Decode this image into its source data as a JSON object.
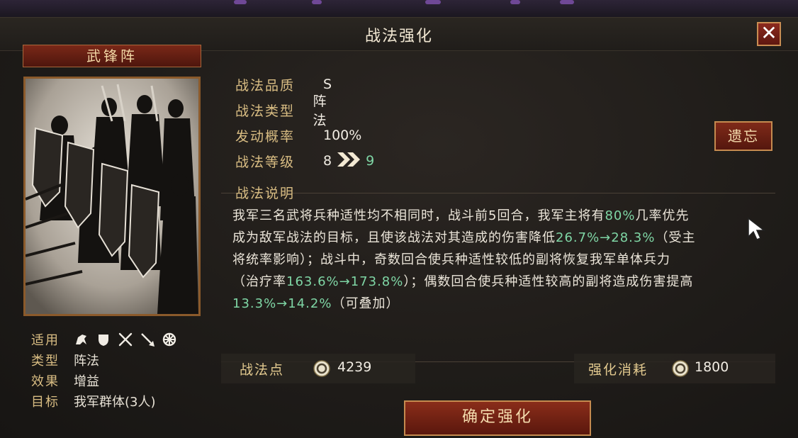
{
  "window": {
    "title": "战法强化",
    "close_label": "✕"
  },
  "skill": {
    "name": "武锋阵"
  },
  "properties": [
    {
      "label": "适用",
      "icons": [
        "cavalry-icon",
        "shield-icon",
        "crossed-swords-icon",
        "spear-icon",
        "wheel-icon"
      ]
    },
    {
      "label": "类型",
      "value": "阵法"
    },
    {
      "label": "效果",
      "value": "增益"
    },
    {
      "label": "目标",
      "value": "我军群体(3人)"
    }
  ],
  "info": {
    "quality_label": "战法品质",
    "quality_value": "S",
    "type_label": "战法类型",
    "type_value": "阵法",
    "rate_label": "发动概率",
    "rate_value": "100%",
    "level_label": "战法等级",
    "level_current": "8",
    "level_next": "9"
  },
  "forget_button": "遗忘",
  "description": {
    "title": "战法说明",
    "lines": [
      [
        {
          "t": "我军三名武将兵种适性均不相同时，战斗前5回合，我军主将有"
        },
        {
          "t": "80%",
          "hl": true
        },
        {
          "t": "几率优先"
        }
      ],
      [
        {
          "t": "成为敌军战法的目标，且使该战法对其造成的伤害降低"
        },
        {
          "t": "26.7%→28.3%",
          "hl": true
        },
        {
          "t": "（受主"
        }
      ],
      [
        {
          "t": "将统率影响）；战斗中，奇数回合使兵种适性较低的副将恢复我军单体兵力"
        }
      ],
      [
        {
          "t": "（治疗率"
        },
        {
          "t": "163.6%→173.8%",
          "hl": true
        },
        {
          "t": "）；偶数回合使兵种适性较高的副将造成伤害提高"
        }
      ],
      [
        {
          "t": "13.3%→14.2%",
          "hl": true
        },
        {
          "t": "（可叠加）"
        }
      ]
    ]
  },
  "points": {
    "label": "战法点",
    "value": "4239"
  },
  "cost": {
    "label": "强化消耗",
    "value": "1800"
  },
  "confirm_button": "确定强化",
  "colors": {
    "gold_label": "#d9bd83",
    "highlight": "#7fd6a5",
    "button_red": "#7f2a19"
  }
}
